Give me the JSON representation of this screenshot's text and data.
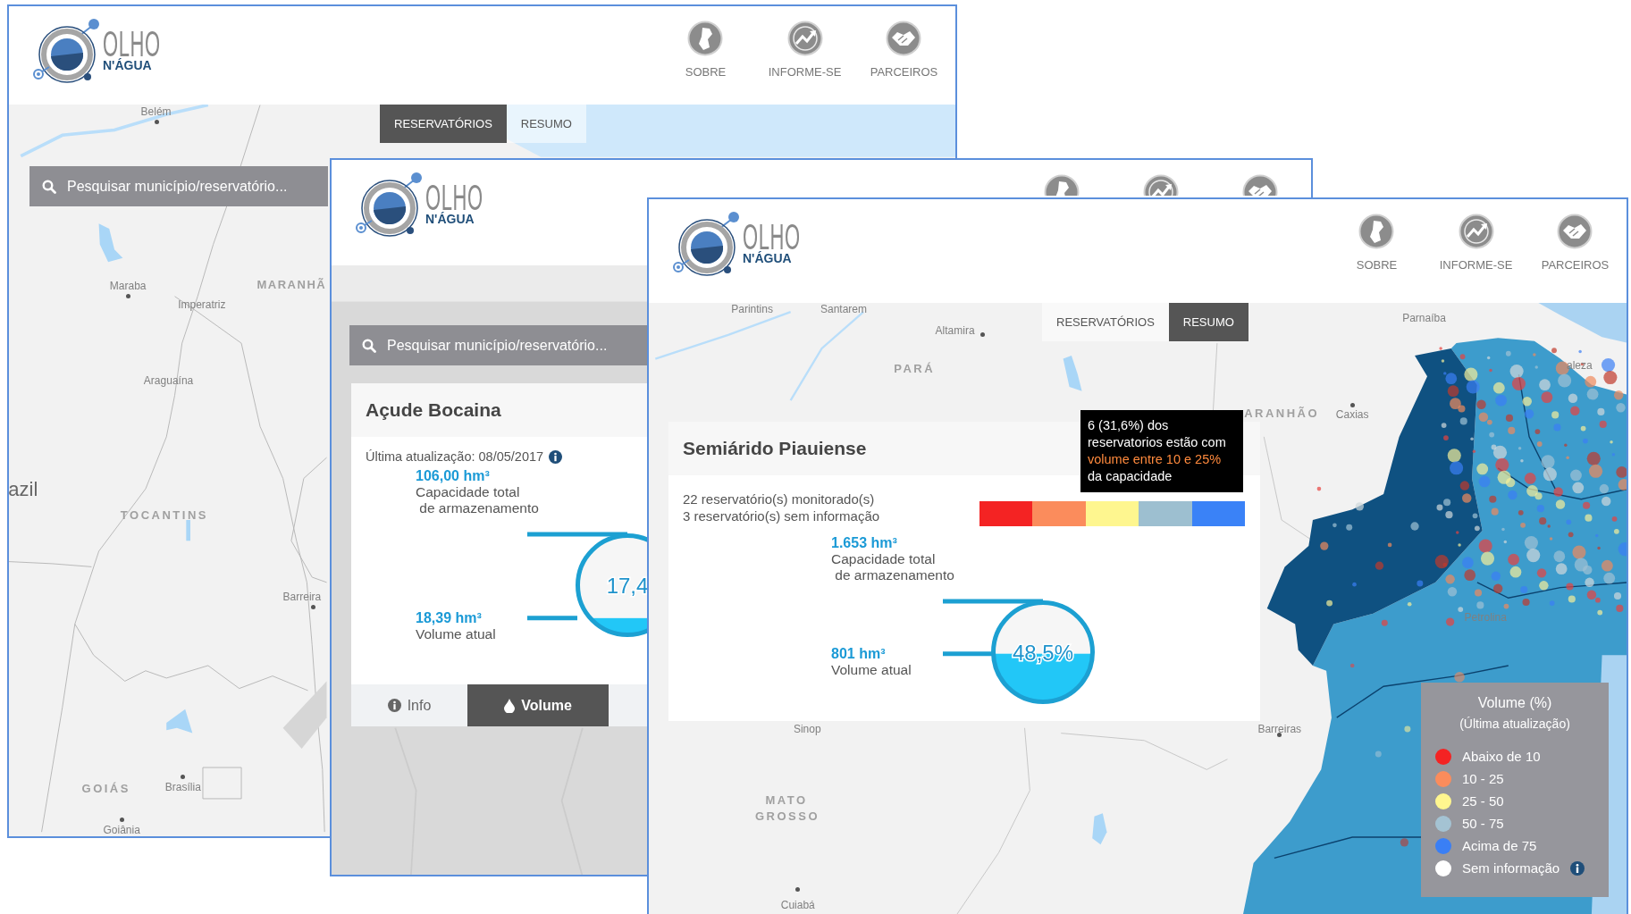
{
  "windows": [
    {
      "logo": {
        "title": "OLHO",
        "subtitle": "N'ÁGUA"
      },
      "nav": [
        {
          "kind": "map",
          "label": "SOBRE"
        },
        {
          "kind": "trend",
          "label": "INFORME-SE"
        },
        {
          "kind": "handshake",
          "label": "PARCEIROS"
        }
      ],
      "tabs": [
        {
          "label": "RESERVATÓRIOS",
          "selected": true
        },
        {
          "label": "RESUMO",
          "selected": false
        }
      ],
      "search": {
        "placeholder": "Pesquisar município/reservatório..."
      },
      "map_labels": [
        {
          "kind": "city",
          "text": "Belém"
        },
        {
          "kind": "city",
          "text": "Maraba"
        },
        {
          "kind": "state",
          "text": "MARANHÃ"
        },
        {
          "kind": "city",
          "text": "Imperatriz"
        },
        {
          "kind": "city",
          "text": "Araguaína"
        },
        {
          "kind": "country",
          "text": "azil"
        },
        {
          "kind": "state",
          "text": "TOCANTINS"
        },
        {
          "kind": "city",
          "text": "Barreira"
        },
        {
          "kind": "state",
          "text": "GOIÁS"
        },
        {
          "kind": "city",
          "text": "Brasília"
        },
        {
          "kind": "city",
          "text": "Goiânia"
        }
      ]
    },
    {
      "logo": {
        "title": "OLHO",
        "subtitle": "N'ÁGUA"
      },
      "nav": [
        {
          "kind": "map"
        },
        {
          "kind": "trend"
        },
        {
          "kind": "handshake"
        }
      ],
      "search": {
        "placeholder": "Pesquisar município/reservatório..."
      },
      "reservoir": {
        "title": "Açude Bocaina",
        "updated": "Última atualização: 08/05/2017",
        "capacity_value": "106,00 hm³",
        "capacity_label": "Capacidade total\n de armazenamento",
        "volume_value": "18,39 hm³",
        "volume_label": "Volume atual",
        "percent": "17,4",
        "level": 0.174,
        "tabs": [
          {
            "kind": "info",
            "label": "Info",
            "selected": false
          },
          {
            "kind": "drop",
            "label": "Volume",
            "selected": true
          }
        ]
      }
    },
    {
      "logo": {
        "title": "OLHO",
        "subtitle": "N'ÁGUA"
      },
      "nav": [
        {
          "kind": "map",
          "label": "SOBRE"
        },
        {
          "kind": "trend",
          "label": "INFORME-SE"
        },
        {
          "kind": "handshake",
          "label": "PARCEIROS"
        }
      ],
      "tabs": [
        {
          "label": "RESERVATÓRIOS",
          "selected": false
        },
        {
          "label": "RESUMO",
          "selected": true
        }
      ],
      "map_labels": [
        {
          "kind": "city",
          "text": "Parintins"
        },
        {
          "kind": "city",
          "text": "Santarem"
        },
        {
          "kind": "city",
          "text": "Altamira"
        },
        {
          "kind": "city",
          "text": "Parnaíba"
        },
        {
          "kind": "state",
          "text": "PARÁ"
        },
        {
          "kind": "state",
          "text": "ARANHÃO"
        },
        {
          "kind": "city",
          "text": "Caxias"
        },
        {
          "kind": "city",
          "text": "aleza"
        },
        {
          "kind": "city",
          "text": "Petrolina"
        },
        {
          "kind": "city",
          "text": "Sinop"
        },
        {
          "kind": "city",
          "text": "Barreiras"
        },
        {
          "kind": "state",
          "text": "MATO GROSSO"
        },
        {
          "kind": "city",
          "text": "Cuiabá"
        }
      ],
      "summary": {
        "title": "Semiárido Piauiense",
        "stats": [
          "22 reservatório(s) monitorado(s)",
          "3 reservatório(s) sem informação"
        ],
        "distribution": [
          {
            "color": "#f42323"
          },
          {
            "color": "#fb8c5c"
          },
          {
            "color": "#fef68f"
          },
          {
            "color": "#9dbfd0"
          },
          {
            "color": "#3a82f7"
          }
        ],
        "capacity_value": "1.653 hm³",
        "capacity_label": "Capacidade total\n de armazenamento",
        "volume_value": "801 hm³",
        "volume_label": "Volume atual",
        "percent": "48,5%",
        "level": 0.485
      },
      "tooltip": {
        "parts": [
          {
            "text": "6 (31,6%) dos reservatorios estão com ",
            "highlight": false
          },
          {
            "text": "volume entre 10 e 25%",
            "highlight": true
          },
          {
            "text": " da capacidade",
            "highlight": false
          }
        ]
      },
      "legend": {
        "title": "Volume (%)",
        "subtitle": "(Última atualização)",
        "items": [
          {
            "label": "Abaixo de 10",
            "color": "#f42323",
            "info": false
          },
          {
            "label": "10 - 25",
            "color": "#fb8c5c",
            "info": false
          },
          {
            "label": "25 - 50",
            "color": "#fff68f",
            "info": false
          },
          {
            "label": "50 - 75",
            "color": "#a4c3d3",
            "info": false
          },
          {
            "label": "Acima de 75",
            "color": "#3a7ff5",
            "info": false
          },
          {
            "label": "Sem informação",
            "color": "#ffffff",
            "info": true
          }
        ]
      }
    }
  ]
}
